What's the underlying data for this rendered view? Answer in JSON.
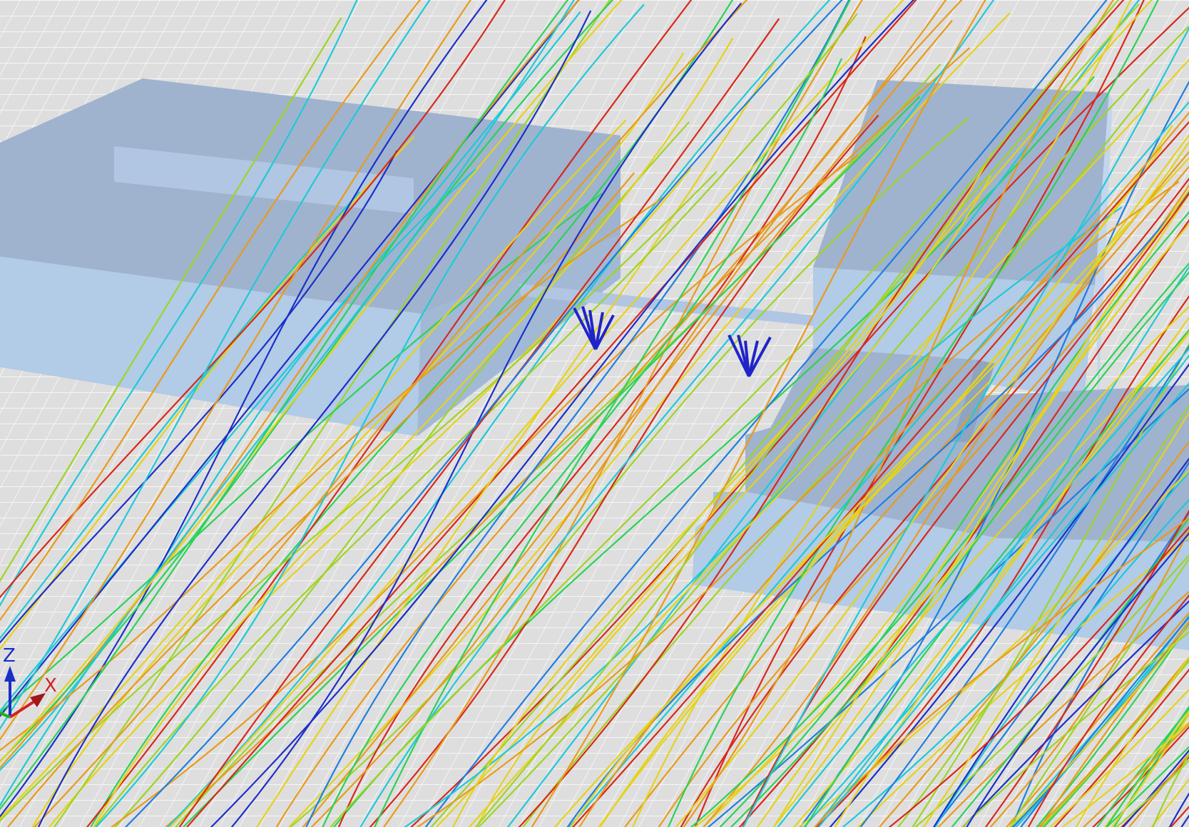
{
  "viewer": {
    "kind": "3D CFD wind-flow streamline view",
    "colors": {
      "ground": "#dedede",
      "grid_line": "#f6f6f6",
      "building_top": "#9fb3cf",
      "building_side": "#b2cbe6",
      "building_dark": "#94a9c6",
      "probe_arrow": "#1f24c8"
    },
    "colormap": [
      "#1c2fc9",
      "#1f7ee0",
      "#1fc9d8",
      "#2bd257",
      "#9fd424",
      "#e5d21a",
      "#e89b1a",
      "#d9281a"
    ],
    "buildings": [
      {
        "name": "building-left"
      },
      {
        "name": "building-right-upper"
      },
      {
        "name": "building-right-lower"
      },
      {
        "name": "connector-bridge"
      }
    ],
    "probes": [
      {
        "name": "velocity-probe-1",
        "icon": "arrow-cluster-icon"
      },
      {
        "name": "velocity-probe-2",
        "icon": "arrow-cluster-icon"
      }
    ],
    "axes": {
      "z_label": "Z",
      "x_label": "X",
      "z_color": "#1a2fc4",
      "x_color": "#d42020",
      "y_color": "#20b020"
    }
  }
}
